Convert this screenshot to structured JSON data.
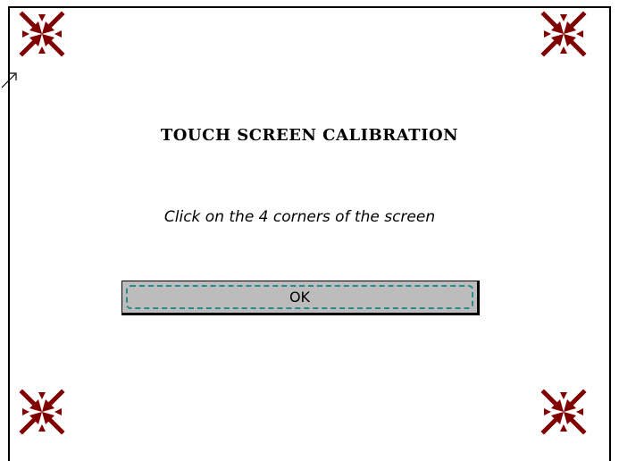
{
  "window": {
    "title": "TOUCH SCREEN CALIBRATION",
    "instruction": "Click on the 4 corners of the screen"
  },
  "buttons": {
    "ok_label": "OK"
  },
  "targets": {
    "icon": "calibration-crosshair-arrows",
    "color": "#800000",
    "corners": [
      "top-left",
      "top-right",
      "bottom-left",
      "bottom-right"
    ]
  },
  "colors": {
    "background": "#ffffff",
    "button_face": "#c8c8c8",
    "focus_ring": "#2a8a8a",
    "target": "#800000"
  }
}
